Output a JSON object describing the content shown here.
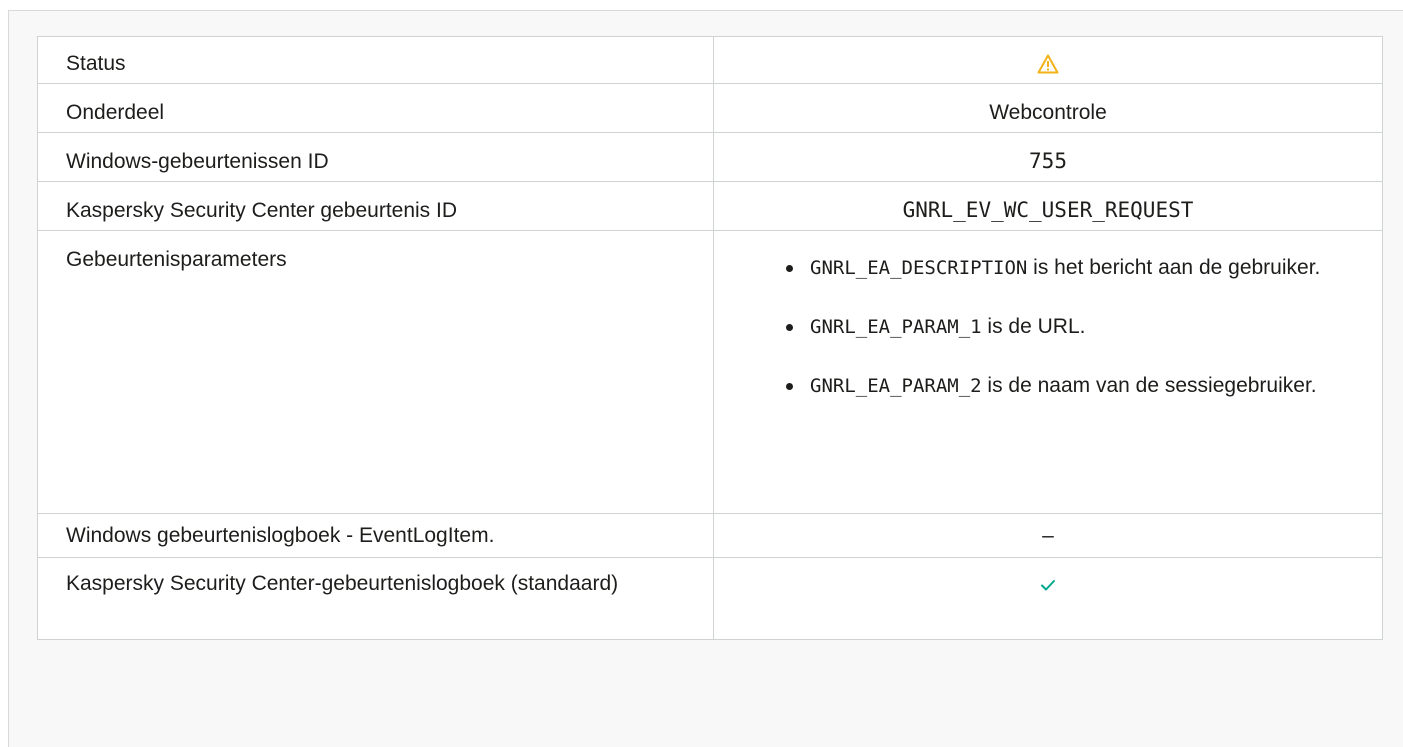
{
  "colors": {
    "warning": "#f2b318",
    "check": "#00a88e"
  },
  "rows": {
    "status": {
      "label": "Status",
      "icon": "warning-triangle-icon"
    },
    "component": {
      "label": "Onderdeel",
      "value": "Webcontrole"
    },
    "windows_event_id": {
      "label": "Windows-gebeurtenissen ID",
      "value": "755"
    },
    "ksc_event_id": {
      "label": "Kaspersky Security Center gebeurtenis ID",
      "value": "GNRL_EV_WC_USER_REQUEST"
    },
    "event_parameters": {
      "label": "Gebeurtenisparameters",
      "items": [
        {
          "code": "GNRL_EA_DESCRIPTION",
          "text": " is het bericht aan de gebruiker."
        },
        {
          "code": "GNRL_EA_PARAM_1",
          "text": " is de URL."
        },
        {
          "code": "GNRL_EA_PARAM_2",
          "text": " is de naam van de sessiegebruiker."
        }
      ]
    },
    "windows_event_log": {
      "label": "Windows gebeurtenislogboek - EventLogItem.",
      "value": "–"
    },
    "ksc_event_log": {
      "label": "Kaspersky Security Center-gebeurtenislogboek (standaard)",
      "icon": "checkmark-icon"
    }
  }
}
